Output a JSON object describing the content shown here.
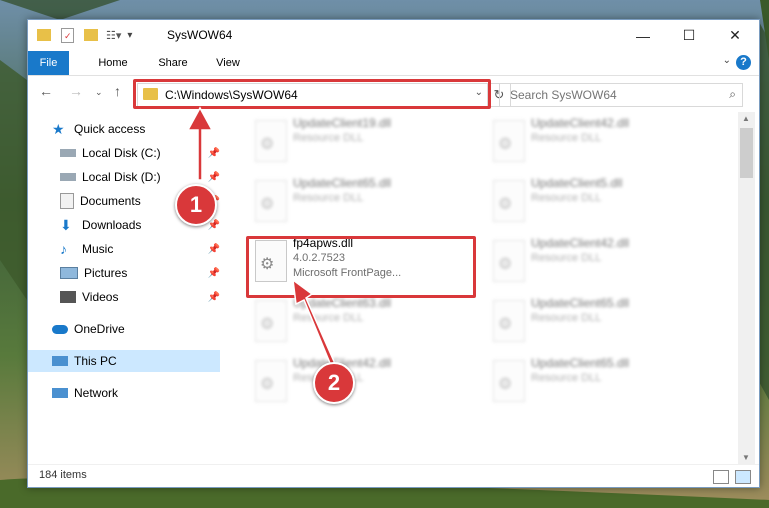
{
  "window": {
    "title": "SysWOW64",
    "controls": {
      "minimize": "—",
      "maximize": "☐",
      "close": "✕"
    }
  },
  "ribbon": {
    "tabs": [
      {
        "label": "File"
      },
      {
        "label": "Home"
      },
      {
        "label": "Share"
      },
      {
        "label": "View"
      }
    ],
    "help": "?"
  },
  "address": {
    "path": "C:\\Windows\\SysWOW64",
    "search_placeholder": "Search SysWOW64"
  },
  "nav": {
    "items": [
      {
        "label": "Quick access",
        "icon": "star-icon"
      },
      {
        "label": "Local Disk (C:)",
        "icon": "drive-icon",
        "pinned": true
      },
      {
        "label": "Local Disk (D:)",
        "icon": "drive-icon",
        "pinned": true
      },
      {
        "label": "Documents",
        "icon": "documents-icon",
        "pinned": true
      },
      {
        "label": "Downloads",
        "icon": "download-icon",
        "pinned": true
      },
      {
        "label": "Music",
        "icon": "music-icon",
        "pinned": true
      },
      {
        "label": "Pictures",
        "icon": "pictures-icon",
        "pinned": true
      },
      {
        "label": "Videos",
        "icon": "videos-icon",
        "pinned": true
      },
      {
        "label": "OneDrive",
        "icon": "cloud-icon"
      },
      {
        "label": "This PC",
        "icon": "computer-icon",
        "selected": true
      },
      {
        "label": "Network",
        "icon": "network-icon"
      }
    ]
  },
  "files": {
    "highlighted": {
      "name": "fp4apws.dll",
      "version": "4.0.2.7523",
      "description": "Microsoft FrontPage..."
    },
    "blurred": [
      {
        "name": "UpdateClient19.dll",
        "type": "Resource DLL"
      },
      {
        "name": "UpdateClient42.dll",
        "type": "Resource DLL"
      },
      {
        "name": "UpdateClient65.dll",
        "type": "Resource DLL"
      },
      {
        "name": "UpdateClient5.dll",
        "type": "Resource DLL"
      },
      {
        "name": "UpdateClient42.dll",
        "type": "Resource DLL"
      },
      {
        "name": "UpdateClient63.dll",
        "type": "Resource DLL"
      },
      {
        "name": "UpdateClient65.dll",
        "type": "Resource DLL"
      },
      {
        "name": "UpdateClient42.dll",
        "type": "Resource DLL"
      },
      {
        "name": "UpdateClient65.dll",
        "type": "Resource DLL"
      }
    ]
  },
  "status": {
    "count": "184 items"
  },
  "callouts": [
    "1",
    "2"
  ],
  "colors": {
    "accent": "#1979ca",
    "highlight": "#d9383a",
    "selected": "#cce8ff"
  }
}
